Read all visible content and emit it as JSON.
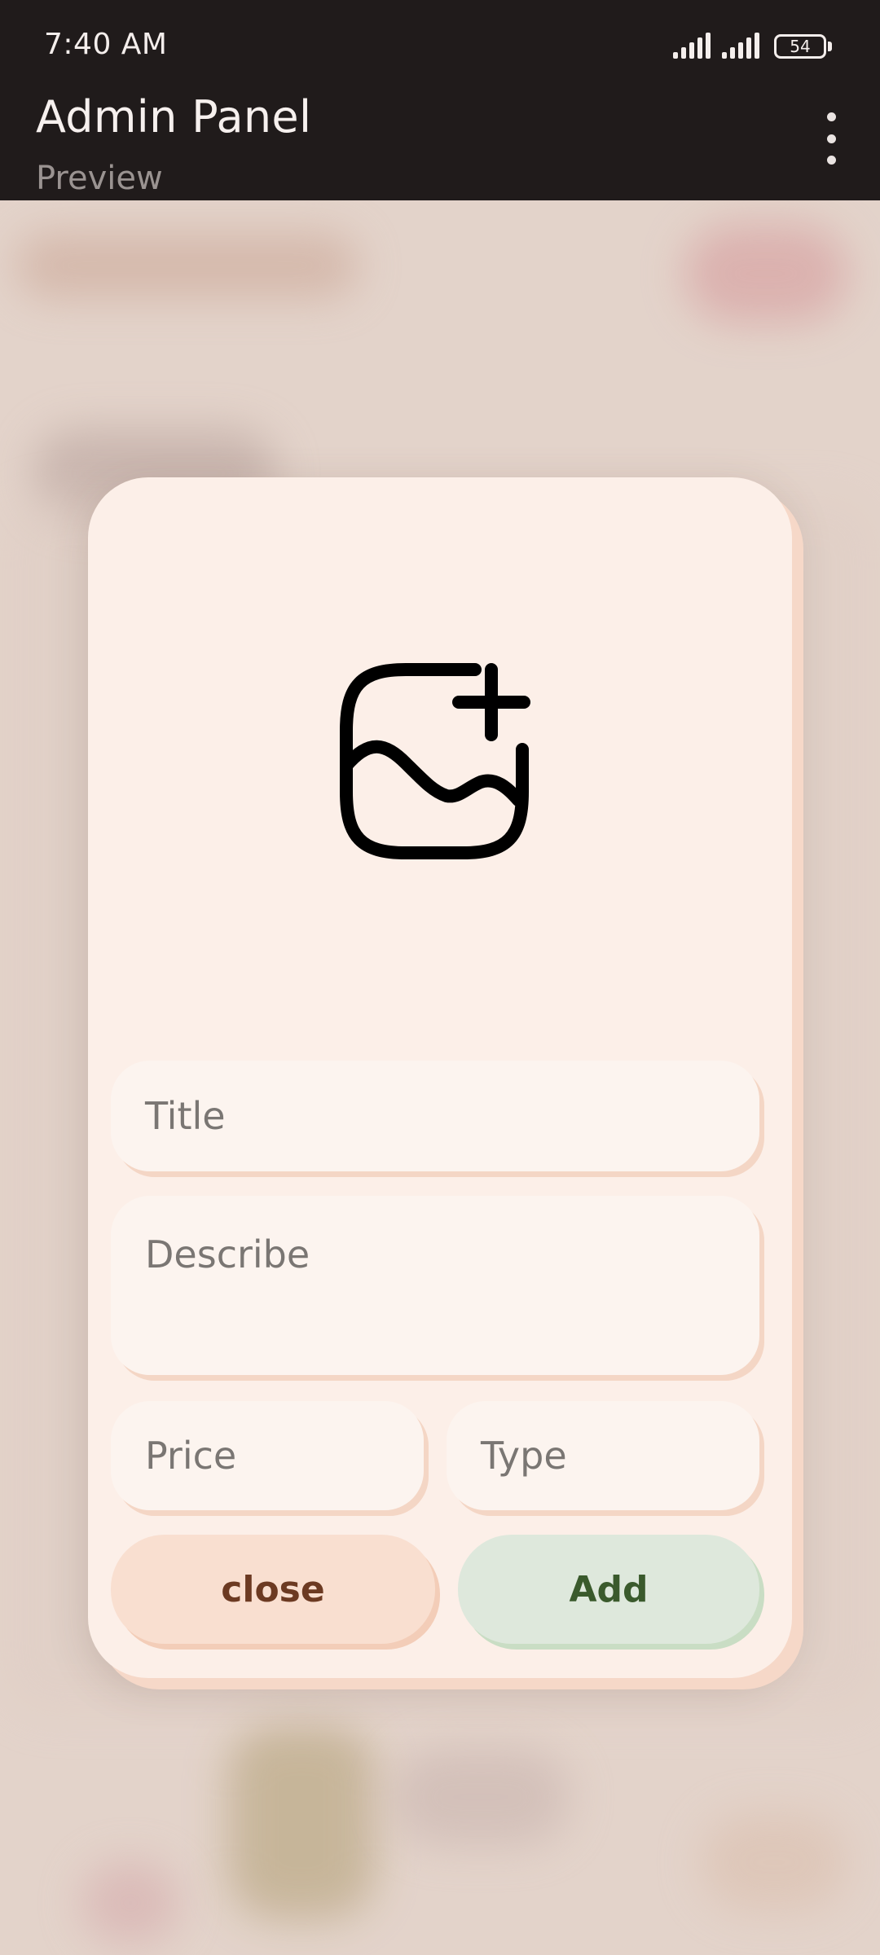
{
  "status_bar": {
    "time": "7:40 AM",
    "battery": "54",
    "icons": [
      "signal-icon",
      "signal-icon",
      "battery-icon"
    ]
  },
  "app_bar": {
    "title": "Admin Panel",
    "subtitle": "Preview",
    "menu_icon": "more-vert-icon"
  },
  "dialog": {
    "image_icon": "add-image-icon",
    "fields": {
      "title_placeholder": "Title",
      "describe_placeholder": "Describe",
      "price_placeholder": "Price",
      "type_placeholder": "Type"
    },
    "buttons": {
      "close_label": "close",
      "add_label": "Add"
    }
  },
  "colors": {
    "top_bar": "#201b1b",
    "dialog_bg": "#fcefe8",
    "close_bg": "#f9dfd0",
    "close_text": "#6c3a22",
    "add_bg": "#dee8dc",
    "add_text": "#3a5a2c"
  }
}
